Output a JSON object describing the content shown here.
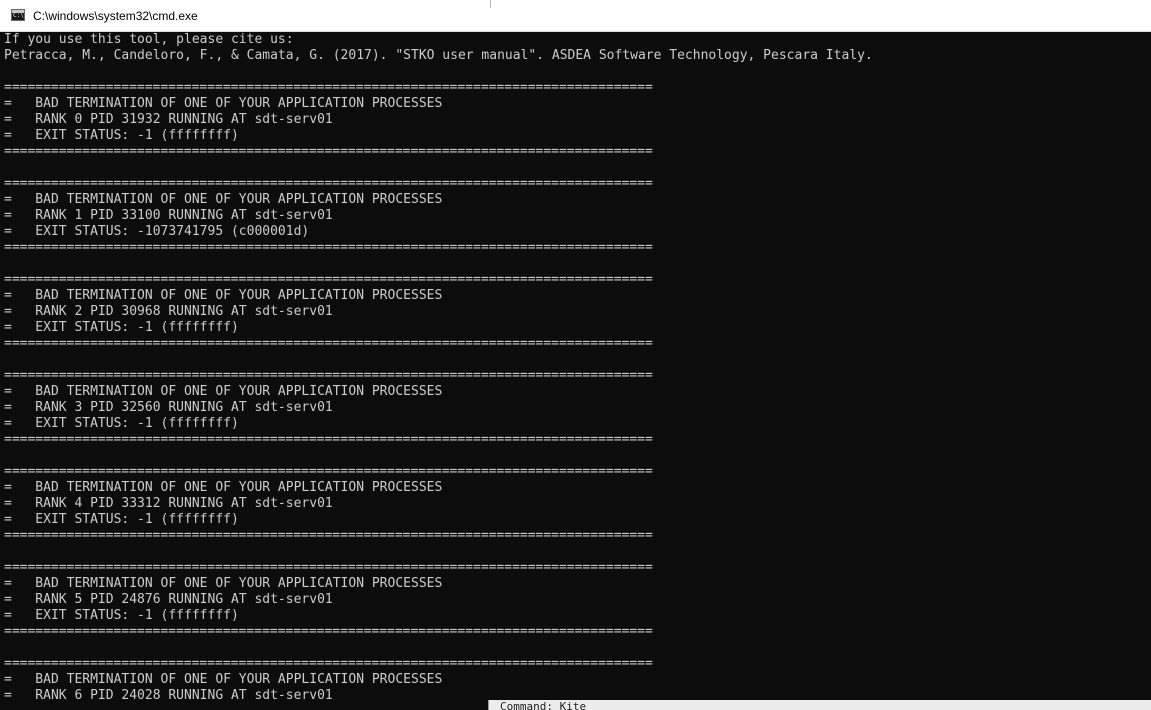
{
  "window": {
    "title": "C:\\windows\\system32\\cmd.exe",
    "icon": "cmd-console-icon",
    "background": "#0c0c0c",
    "text_color": "#cccccc"
  },
  "console": {
    "citation": [
      "If you use this tool, please cite us:",
      "Petracca, M., Candeloro, F., & Camata, G. (2017). \"STKO user manual\". ASDEA Software Technology, Pescara Italy."
    ],
    "separator": "===================================================================================",
    "heading": "=   BAD TERMINATION OF ONE OF YOUR APPLICATION PROCESSES",
    "blocks": [
      {
        "rank_line": "=   RANK 0 PID 31932 RUNNING AT sdt-serv01",
        "exit_line": "=   EXIT STATUS: -1 (ffffffff)"
      },
      {
        "rank_line": "=   RANK 1 PID 33100 RUNNING AT sdt-serv01",
        "exit_line": "=   EXIT STATUS: -1073741795 (c000001d)"
      },
      {
        "rank_line": "=   RANK 2 PID 30968 RUNNING AT sdt-serv01",
        "exit_line": "=   EXIT STATUS: -1 (ffffffff)"
      },
      {
        "rank_line": "=   RANK 3 PID 32560 RUNNING AT sdt-serv01",
        "exit_line": "=   EXIT STATUS: -1 (ffffffff)"
      },
      {
        "rank_line": "=   RANK 4 PID 33312 RUNNING AT sdt-serv01",
        "exit_line": "=   EXIT STATUS: -1 (ffffffff)"
      },
      {
        "rank_line": "=   RANK 5 PID 24876 RUNNING AT sdt-serv01",
        "exit_line": "=   EXIT STATUS: -1 (ffffffff)"
      },
      {
        "rank_line": "=   RANK 6 PID 24028 RUNNING AT sdt-serv01",
        "exit_line": ""
      }
    ]
  },
  "background_window": {
    "partial_text": "Command: Kite"
  }
}
